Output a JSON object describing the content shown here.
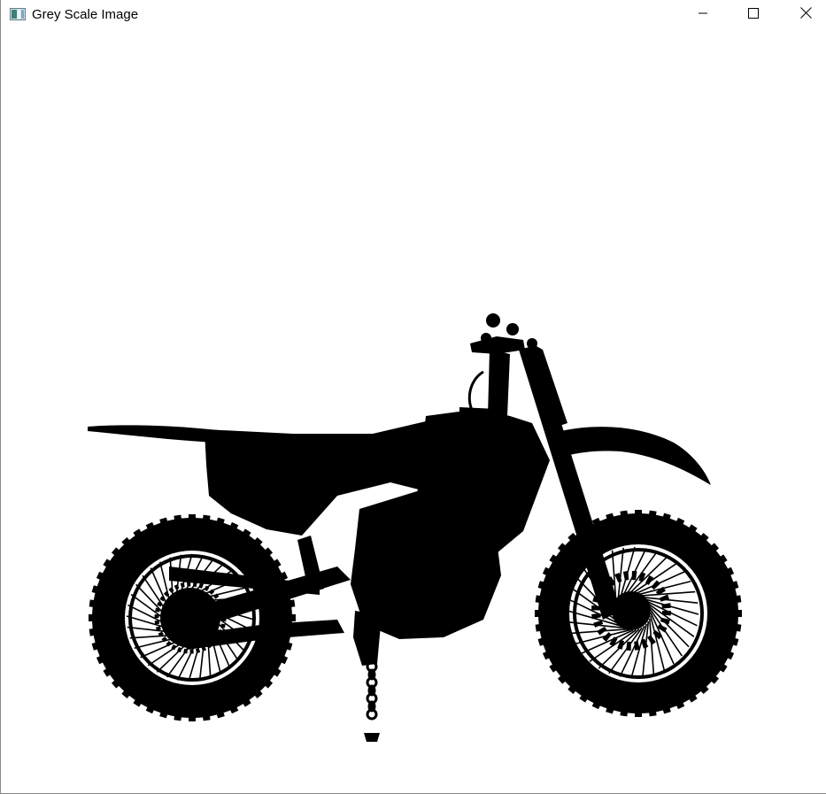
{
  "window": {
    "title": "Grey Scale Image",
    "app_icon": "image-window-icon",
    "controls": {
      "minimize_icon": "minimize-icon",
      "maximize_icon": "maximize-icon",
      "close_icon": "close-icon"
    }
  },
  "image": {
    "subject": "motorcycle silhouette",
    "foreground_color": "#000000",
    "background_color": "#ffffff"
  }
}
